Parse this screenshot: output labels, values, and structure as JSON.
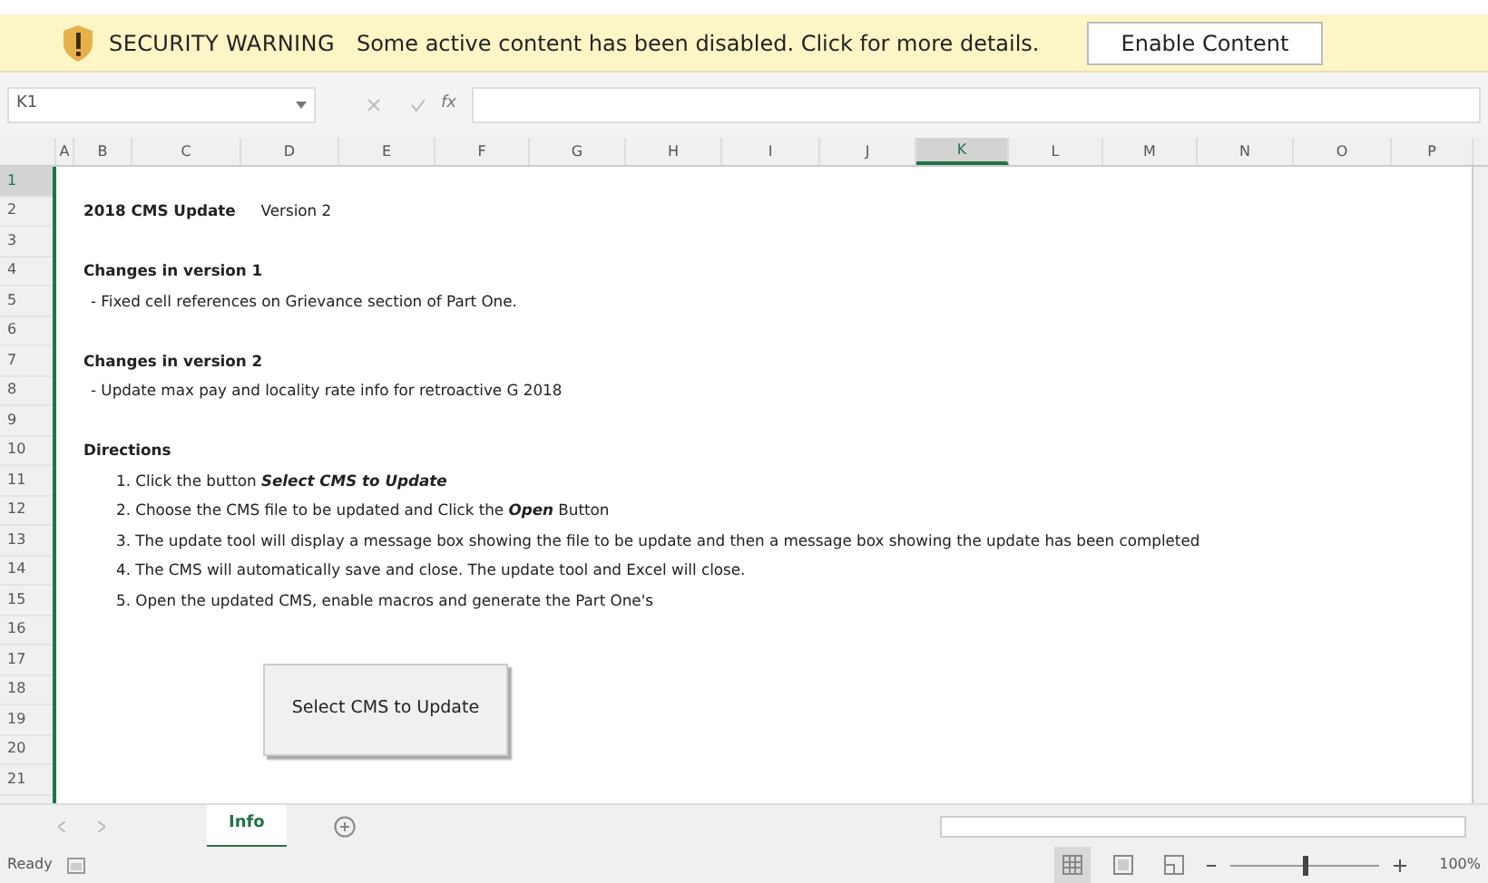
{
  "security_bar": {
    "title": "SECURITY WARNING",
    "message": "Some active content has been disabled. Click for more details.",
    "button": "Enable Content"
  },
  "formula_bar": {
    "name_box": "K1",
    "function_button": "fx"
  },
  "columns": [
    {
      "label": "A",
      "selected": false
    },
    {
      "label": "B",
      "selected": false
    },
    {
      "label": "C",
      "selected": false
    },
    {
      "label": "D",
      "selected": false
    },
    {
      "label": "E",
      "selected": false
    },
    {
      "label": "F",
      "selected": false
    },
    {
      "label": "G",
      "selected": false
    },
    {
      "label": "H",
      "selected": false
    },
    {
      "label": "I",
      "selected": false
    },
    {
      "label": "J",
      "selected": false
    },
    {
      "label": "K",
      "selected": true
    },
    {
      "label": "L",
      "selected": false
    },
    {
      "label": "M",
      "selected": false
    },
    {
      "label": "N",
      "selected": false
    },
    {
      "label": "O",
      "selected": false
    },
    {
      "label": "P",
      "selected": false
    }
  ],
  "rows": [
    {
      "number": "1",
      "selected": true,
      "cells": []
    },
    {
      "number": "2",
      "selected": false,
      "cells": [
        {
          "kind": "heading",
          "text": "2018 CMS Update"
        },
        {
          "kind": "plain",
          "text": "Version 2"
        }
      ]
    },
    {
      "number": "3",
      "selected": false,
      "cells": []
    },
    {
      "number": "4",
      "selected": false,
      "cells": [
        {
          "kind": "heading",
          "text": "Changes in version 1"
        }
      ]
    },
    {
      "number": "5",
      "selected": false,
      "cells": [
        {
          "kind": "note",
          "text": "- Fixed cell references on Grievance section of Part One."
        }
      ]
    },
    {
      "number": "6",
      "selected": false,
      "cells": []
    },
    {
      "number": "7",
      "selected": false,
      "cells": [
        {
          "kind": "heading",
          "text": "Changes in version 2"
        }
      ]
    },
    {
      "number": "8",
      "selected": false,
      "cells": [
        {
          "kind": "note",
          "text": "- Update max pay and locality rate info for retroactive G 2018"
        }
      ]
    },
    {
      "number": "9",
      "selected": false,
      "cells": []
    },
    {
      "number": "10",
      "selected": false,
      "cells": [
        {
          "kind": "heading",
          "text": "Directions"
        }
      ]
    },
    {
      "number": "11",
      "selected": false,
      "cells": [
        {
          "kind": "step",
          "text": "1. Click the button **Select CMS to Update**"
        }
      ]
    },
    {
      "number": "12",
      "selected": false,
      "cells": [
        {
          "kind": "step",
          "text": "2. Choose the CMS file to be updated and Click the **Open** Button"
        }
      ]
    },
    {
      "number": "13",
      "selected": false,
      "cells": [
        {
          "kind": "step",
          "text": "3. The update tool will display a message box showing the file to be update and then a message box showing the update has been completed"
        }
      ]
    },
    {
      "number": "14",
      "selected": false,
      "cells": [
        {
          "kind": "step",
          "text": "4. The CMS will automatically save and close. The update tool and Excel will close."
        }
      ]
    },
    {
      "number": "15",
      "selected": false,
      "cells": [
        {
          "kind": "step",
          "text": "5. Open the updated CMS, enable macros and generate the Part One's"
        }
      ]
    },
    {
      "number": "16",
      "selected": false,
      "cells": []
    },
    {
      "number": "17",
      "selected": false,
      "cells": []
    },
    {
      "number": "18",
      "selected": false,
      "cells": []
    },
    {
      "number": "19",
      "selected": false,
      "cells": []
    },
    {
      "number": "20",
      "selected": false,
      "cells": []
    },
    {
      "number": "21",
      "selected": false,
      "cells": []
    }
  ],
  "sheet_button": {
    "label": "Select CMS to Update"
  },
  "sheet_tabs": [
    {
      "label": "Info",
      "selected": true
    }
  ],
  "status_bar": {
    "status": "Ready",
    "views": [
      {
        "kind": "normal",
        "selected": true
      },
      {
        "kind": "layout",
        "selected": false
      },
      {
        "kind": "pagebreak",
        "selected": false
      }
    ],
    "zoom": {
      "level": 0.5,
      "reading": "100%"
    }
  }
}
